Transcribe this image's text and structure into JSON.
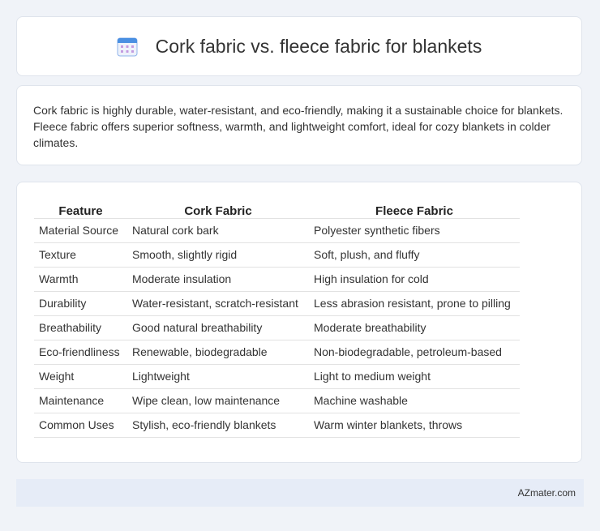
{
  "header": {
    "title": "Cork fabric vs. fleece fabric for blankets"
  },
  "summary": {
    "text": "Cork fabric is highly durable, water-resistant, and eco-friendly, making it a sustainable choice for blankets. Fleece fabric offers superior softness, warmth, and lightweight comfort, ideal for cozy blankets in colder climates."
  },
  "table": {
    "headers": [
      "Feature",
      "Cork Fabric",
      "Fleece Fabric"
    ],
    "rows": [
      [
        "Material Source",
        "Natural cork bark",
        "Polyester synthetic fibers"
      ],
      [
        "Texture",
        "Smooth, slightly rigid",
        "Soft, plush, and fluffy"
      ],
      [
        "Warmth",
        "Moderate insulation",
        "High insulation for cold"
      ],
      [
        "Durability",
        "Water-resistant, scratch-resistant",
        "Less abrasion resistant, prone to pilling"
      ],
      [
        "Breathability",
        "Good natural breathability",
        "Moderate breathability"
      ],
      [
        "Eco-friendliness",
        "Renewable, biodegradable",
        "Non-biodegradable, petroleum-based"
      ],
      [
        "Weight",
        "Lightweight",
        "Light to medium weight"
      ],
      [
        "Maintenance",
        "Wipe clean, low maintenance",
        "Machine washable"
      ],
      [
        "Common Uses",
        "Stylish, eco-friendly blankets",
        "Warm winter blankets, throws"
      ]
    ]
  },
  "footer": {
    "brand": "AZmater.com"
  },
  "icons": {
    "title_icon": "calendar-icon"
  },
  "colors": {
    "background": "#f0f3f8",
    "footer_bg": "#e6ecf7",
    "icon_primary": "#4a90e2",
    "icon_accent": "#c39be0"
  }
}
